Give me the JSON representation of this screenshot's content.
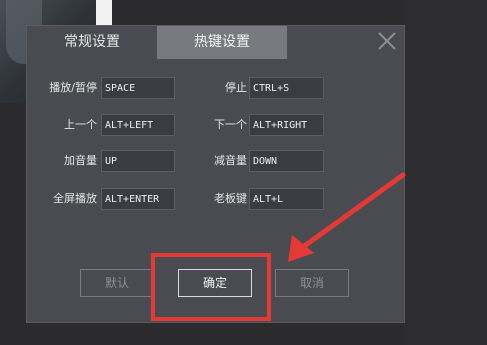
{
  "dialog": {
    "tabs": [
      {
        "label": "常规设置",
        "active": false
      },
      {
        "label": "热键设置",
        "active": true
      }
    ],
    "close_icon": "close-icon",
    "hotkeys_left": [
      {
        "label": "播放/暂停",
        "value": "SPACE"
      },
      {
        "label": "上一个",
        "value": "ALT+LEFT"
      },
      {
        "label": "加音量",
        "value": "UP"
      },
      {
        "label": "全屏播放",
        "value": "ALT+ENTER"
      }
    ],
    "hotkeys_right": [
      {
        "label": "停止",
        "value": "CTRL+S"
      },
      {
        "label": "下一个",
        "value": "ALT+RIGHT"
      },
      {
        "label": "减音量",
        "value": "DOWN"
      },
      {
        "label": "老板键",
        "value": "ALT+L"
      }
    ],
    "buttons": {
      "default": "默认",
      "ok": "确定",
      "cancel": "取消"
    }
  },
  "annotation": {
    "highlight_color": "#e53935",
    "arrow_color": "#e53935"
  }
}
